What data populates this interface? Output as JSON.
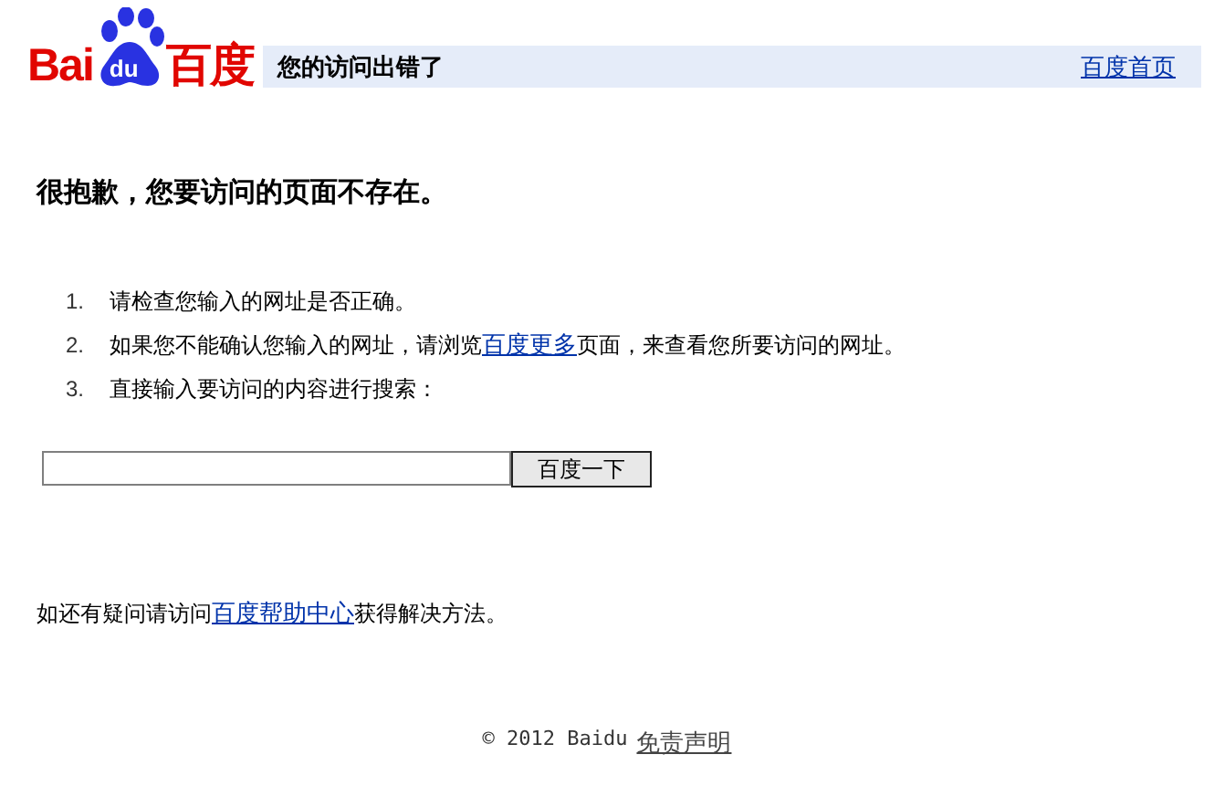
{
  "logo": {
    "left": "Bai",
    "badge": "du",
    "right": "百度"
  },
  "header": {
    "title": "您的访问出错了",
    "home_link": "百度首页"
  },
  "heading": "很抱歉，您要访问的页面不存在。",
  "steps": [
    {
      "number": "1.",
      "before": "请检查您输入的网址是否正确。"
    },
    {
      "number": "2.",
      "before": "如果您不能确认您输入的网址，请浏览",
      "link": "百度更多",
      "after": "页面，来查看您所要访问的网址。"
    },
    {
      "number": "3.",
      "before": "直接输入要访问的内容进行搜索："
    }
  ],
  "search": {
    "button": "百度一下"
  },
  "help": {
    "before": "如还有疑问请访问",
    "link": "百度帮助中心",
    "after": "获得解决方法。"
  },
  "footer": {
    "copyright": "© 2012 Baidu",
    "link": "免责声明"
  }
}
